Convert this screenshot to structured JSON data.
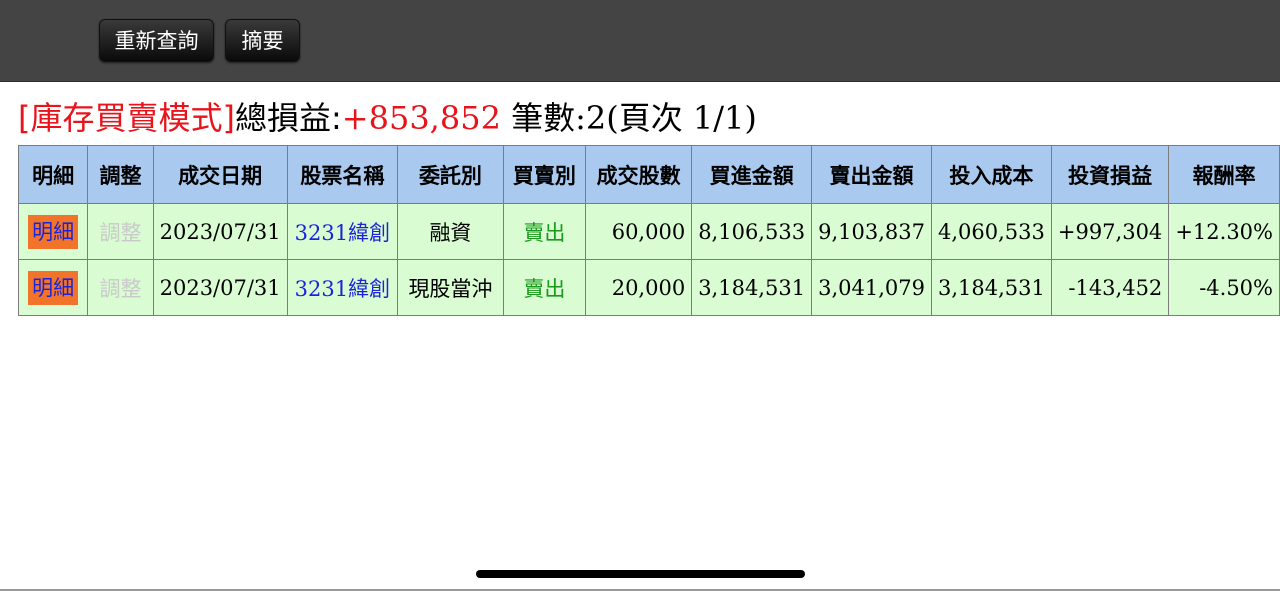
{
  "toolbar": {
    "requery_label": "重新查詢",
    "summary_label": "摘要"
  },
  "summary": {
    "mode": "[庫存買賣模式]",
    "total_pl_label": "總損益:",
    "total_pl_value": "+853,852",
    "count_text": "筆數:2(頁次 1/1)"
  },
  "table": {
    "headers": [
      "明細",
      "調整",
      "成交日期",
      "股票名稱",
      "委託別",
      "買賣別",
      "成交股數",
      "買進金額",
      "賣出金額",
      "投入成本",
      "投資損益",
      "報酬率"
    ],
    "rows": [
      {
        "detail": "明細",
        "adjust": "調整",
        "date": "2023/07/31",
        "stock": "3231緯創",
        "order_type": "融資",
        "side": "賣出",
        "shares": "60,000",
        "buy_amount": "8,106,533",
        "sell_amount": "9,103,837",
        "cost": "4,060,533",
        "pl": "+997,304",
        "roi": "+12.30%"
      },
      {
        "detail": "明細",
        "adjust": "調整",
        "date": "2023/07/31",
        "stock": "3231緯創",
        "order_type": "現股當沖",
        "side": "賣出",
        "shares": "20,000",
        "buy_amount": "3,184,531",
        "sell_amount": "3,041,079",
        "cost": "3,184,531",
        "pl": "-143,452",
        "roi": "-4.50%"
      }
    ]
  },
  "colors": {
    "header_bg": "#a9c9ee",
    "row_bg": "#d9fcd2",
    "positive": "#e8141c",
    "negative": "#1a9a1a",
    "detail_button_bg": "#f2732a",
    "link": "#1a24d8"
  }
}
